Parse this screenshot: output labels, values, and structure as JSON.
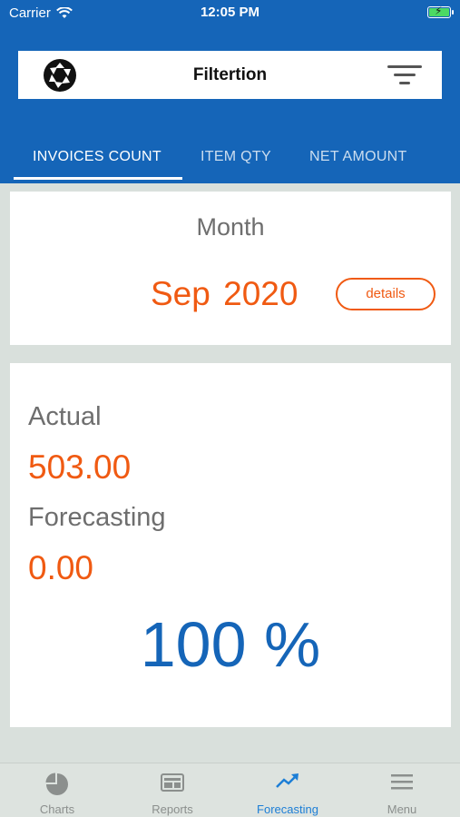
{
  "status_bar": {
    "carrier": "Carrier",
    "time": "12:05 PM"
  },
  "header": {
    "title": "Filtertion"
  },
  "tabs": [
    {
      "label": "INVOICES COUNT",
      "active": true
    },
    {
      "label": "ITEM QTY",
      "active": false
    },
    {
      "label": "NET AMOUNT",
      "active": false
    }
  ],
  "month_card": {
    "label": "Month",
    "month": "Sep",
    "year": "2020",
    "details_label": "details"
  },
  "stats_card": {
    "actual_label": "Actual",
    "actual_value": "503.00",
    "forecasting_label": "Forecasting",
    "forecasting_value": "0.00",
    "percent": "100 %"
  },
  "bottom_nav": [
    {
      "label": "Charts",
      "icon": "pie-chart-icon",
      "active": false
    },
    {
      "label": "Reports",
      "icon": "report-icon",
      "active": false
    },
    {
      "label": "Forecasting",
      "icon": "trending-up-icon",
      "active": true
    },
    {
      "label": "Menu",
      "icon": "menu-icon",
      "active": false
    }
  ],
  "colors": {
    "primary": "#1565b8",
    "accent": "#f05a12",
    "active_nav": "#1c7ed6"
  }
}
